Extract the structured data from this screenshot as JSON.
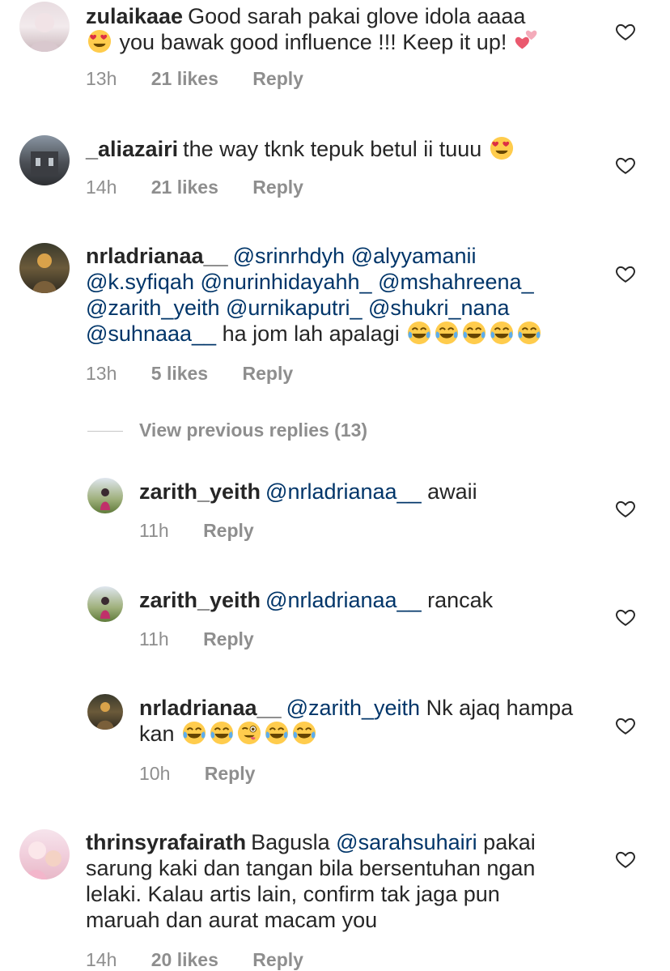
{
  "comments": [
    {
      "username": "zulaikaae",
      "text_pre": "Good sarah pakai glove idola aaaa",
      "text_post": "you bawak good influence !!! Keep it up!",
      "time": "13h",
      "likes": "21 likes",
      "reply": "Reply"
    },
    {
      "username": "_aliazairi",
      "text": "the way tknk tepuk betul ii tuuu",
      "time": "14h",
      "likes": "21 likes",
      "reply": "Reply"
    },
    {
      "username": "nrladrianaa__",
      "mentions": [
        "@srinrhdyh",
        "@alyyamanii",
        "@k.syfiqah",
        "@nurinhidayahh_",
        "@mshahreena_",
        "@zarith_yeith",
        "@urnikaputri_",
        "@shukri_nana",
        "@suhnaaa__"
      ],
      "text": "ha jom lah apalagi",
      "time": "13h",
      "likes": "5 likes",
      "reply": "Reply"
    },
    {
      "username": "thrinsyrafairath",
      "text_pre": "Bagusla",
      "mention": "@sarahsuhairi",
      "text_post": "pakai sarung kaki dan tangan bila bersentuhan ngan lelaki. Kalau artis lain, confirm tak jaga pun maruah dan aurat macam you",
      "time": "14h",
      "likes": "20 likes",
      "reply": "Reply"
    }
  ],
  "view_previous": "View previous replies (13)",
  "replies": [
    {
      "username": "zarith_yeith",
      "mention": "@nrladrianaa__",
      "text": "awaii",
      "time": "11h",
      "reply": "Reply"
    },
    {
      "username": "zarith_yeith",
      "mention": "@nrladrianaa__",
      "text": "rancak",
      "time": "11h",
      "reply": "Reply"
    },
    {
      "username": "nrladrianaa__",
      "mention": "@zarith_yeith",
      "text": "Nk ajaq hampa kan",
      "time": "10h",
      "reply": "Reply"
    }
  ],
  "colors": {
    "mention": "#003569",
    "meta": "#8e8e8e",
    "text": "#262626"
  },
  "icons": [
    "heart-outline-icon",
    "heart-eyes-emoji",
    "two-hearts-emoji",
    "tears-of-joy-emoji",
    "winking-tongue-emoji"
  ]
}
